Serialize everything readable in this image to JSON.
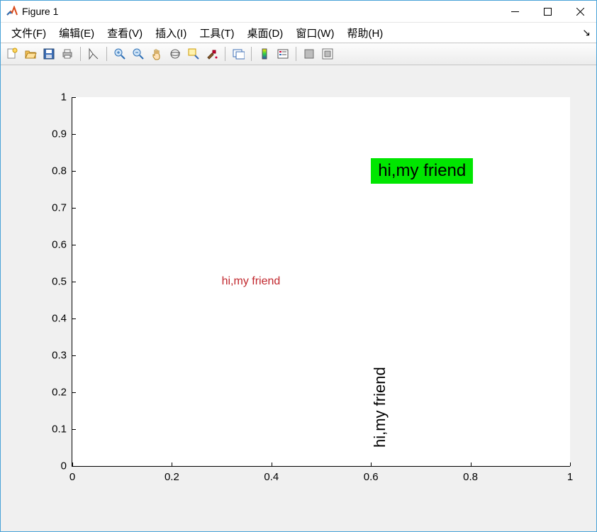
{
  "window": {
    "title": "Figure 1"
  },
  "menu": {
    "file": "文件(F)",
    "edit": "编辑(E)",
    "view": "查看(V)",
    "insert": "插入(I)",
    "tools": "工具(T)",
    "desktop": "桌面(D)",
    "window": "窗口(W)",
    "help": "帮助(H)"
  },
  "chart_data": {
    "type": "scatter",
    "xlim": [
      0,
      1
    ],
    "ylim": [
      0,
      1
    ],
    "xticks": [
      0,
      0.2,
      0.4,
      0.6,
      0.8,
      1
    ],
    "yticks": [
      0,
      0.1,
      0.2,
      0.3,
      0.4,
      0.5,
      0.6,
      0.7,
      0.8,
      0.9,
      1
    ],
    "xticklabels": [
      "0",
      "0.2",
      "0.4",
      "0.6",
      "0.8",
      "1"
    ],
    "yticklabels": [
      "0",
      "0.1",
      "0.2",
      "0.3",
      "0.4",
      "0.5",
      "0.6",
      "0.7",
      "0.8",
      "0.9",
      "1"
    ],
    "annotations": [
      {
        "text": "hi,my friend",
        "x": 0.3,
        "y": 0.5,
        "color": "#c1272d",
        "background": "none",
        "fontsize": 16,
        "rotation": 0
      },
      {
        "text": "hi,my friend",
        "x": 0.6,
        "y": 0.8,
        "color": "#000000",
        "background": "#00e600",
        "fontsize": 24,
        "rotation": 0
      },
      {
        "text": "hi,my friend",
        "x": 0.6,
        "y": 0.1,
        "color": "#000000",
        "background": "none",
        "fontsize": 22,
        "rotation": 90
      }
    ]
  }
}
